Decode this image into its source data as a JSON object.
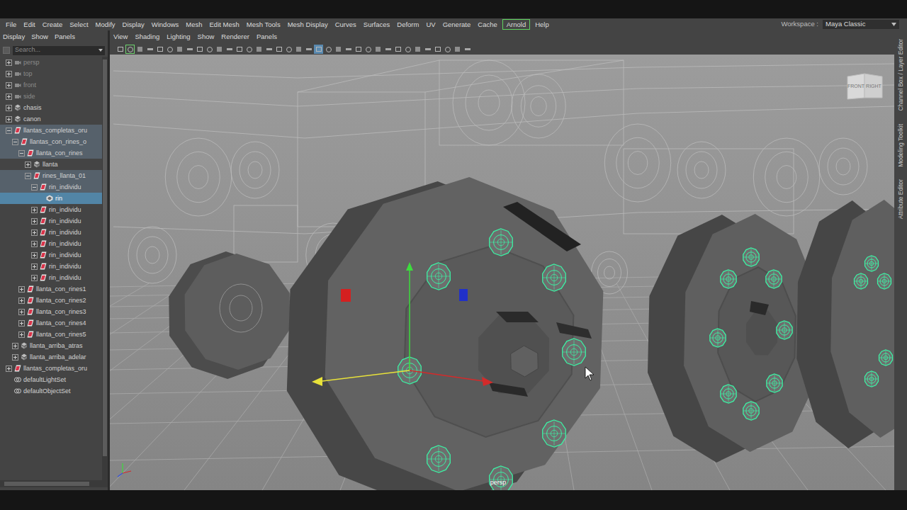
{
  "menubar": {
    "items": [
      {
        "label": "File",
        "highlighted": false
      },
      {
        "label": "Edit",
        "highlighted": false
      },
      {
        "label": "Create",
        "highlighted": false
      },
      {
        "label": "Select",
        "highlighted": false
      },
      {
        "label": "Modify",
        "highlighted": false
      },
      {
        "label": "Display",
        "highlighted": false
      },
      {
        "label": "Windows",
        "highlighted": false
      },
      {
        "label": "Mesh",
        "highlighted": false
      },
      {
        "label": "Edit Mesh",
        "highlighted": false
      },
      {
        "label": "Mesh Tools",
        "highlighted": false
      },
      {
        "label": "Mesh Display",
        "highlighted": false
      },
      {
        "label": "Curves",
        "highlighted": false
      },
      {
        "label": "Surfaces",
        "highlighted": false
      },
      {
        "label": "Deform",
        "highlighted": false
      },
      {
        "label": "UV",
        "highlighted": false
      },
      {
        "label": "Generate",
        "highlighted": false
      },
      {
        "label": "Cache",
        "highlighted": false
      },
      {
        "label": "Arnold",
        "highlighted": true
      },
      {
        "label": "Help",
        "highlighted": false
      }
    ],
    "workspace_label": "Workspace :",
    "workspace_value": "Maya Classic"
  },
  "outliner": {
    "menu": [
      "Display",
      "Show",
      "Panels"
    ],
    "search": {
      "placeholder": "Search..."
    },
    "items": [
      {
        "label": "persp",
        "depth": 0,
        "has_children": true,
        "expanded": false,
        "kind": "camera",
        "selected": false,
        "ancestor": false,
        "dimmed": true
      },
      {
        "label": "top",
        "depth": 0,
        "has_children": true,
        "expanded": false,
        "kind": "camera",
        "selected": false,
        "ancestor": false,
        "dimmed": true
      },
      {
        "label": "front",
        "depth": 0,
        "has_children": true,
        "expanded": false,
        "kind": "camera",
        "selected": false,
        "ancestor": false,
        "dimmed": true
      },
      {
        "label": "side",
        "depth": 0,
        "has_children": true,
        "expanded": false,
        "kind": "camera",
        "selected": false,
        "ancestor": false,
        "dimmed": true
      },
      {
        "label": "chasis",
        "depth": 0,
        "has_children": true,
        "expanded": false,
        "kind": "group",
        "selected": false,
        "ancestor": false,
        "dimmed": false
      },
      {
        "label": "canon",
        "depth": 0,
        "has_children": true,
        "expanded": false,
        "kind": "group",
        "selected": false,
        "ancestor": false,
        "dimmed": false
      },
      {
        "label": "llantas_completas_oru",
        "depth": 0,
        "has_children": true,
        "expanded": true,
        "kind": "transform",
        "selected": false,
        "ancestor": true,
        "dimmed": false
      },
      {
        "label": "llantas_con_rines_o",
        "depth": 1,
        "has_children": true,
        "expanded": true,
        "kind": "transform",
        "selected": false,
        "ancestor": true,
        "dimmed": false
      },
      {
        "label": "llanta_con_rines",
        "depth": 2,
        "has_children": true,
        "expanded": true,
        "kind": "transform",
        "selected": false,
        "ancestor": true,
        "dimmed": false
      },
      {
        "label": "llanta",
        "depth": 3,
        "has_children": true,
        "expanded": false,
        "kind": "group",
        "selected": false,
        "ancestor": false,
        "dimmed": false
      },
      {
        "label": "rines_llanta_01",
        "depth": 3,
        "has_children": true,
        "expanded": true,
        "kind": "transform",
        "selected": false,
        "ancestor": true,
        "dimmed": false
      },
      {
        "label": "rin_individu",
        "depth": 4,
        "has_children": true,
        "expanded": true,
        "kind": "transform",
        "selected": false,
        "ancestor": true,
        "dimmed": false
      },
      {
        "label": "rin",
        "depth": 5,
        "has_children": false,
        "expanded": false,
        "kind": "mesh",
        "selected": true,
        "ancestor": false,
        "dimmed": false
      },
      {
        "label": "rin_individu",
        "depth": 4,
        "has_children": true,
        "expanded": false,
        "kind": "transform",
        "selected": false,
        "ancestor": false,
        "dimmed": false
      },
      {
        "label": "rin_individu",
        "depth": 4,
        "has_children": true,
        "expanded": false,
        "kind": "transform",
        "selected": false,
        "ancestor": false,
        "dimmed": false
      },
      {
        "label": "rin_individu",
        "depth": 4,
        "has_children": true,
        "expanded": false,
        "kind": "transform",
        "selected": false,
        "ancestor": false,
        "dimmed": false
      },
      {
        "label": "rin_individu",
        "depth": 4,
        "has_children": true,
        "expanded": false,
        "kind": "transform",
        "selected": false,
        "ancestor": false,
        "dimmed": false
      },
      {
        "label": "rin_individu",
        "depth": 4,
        "has_children": true,
        "expanded": false,
        "kind": "transform",
        "selected": false,
        "ancestor": false,
        "dimmed": false
      },
      {
        "label": "rin_individu",
        "depth": 4,
        "has_children": true,
        "expanded": false,
        "kind": "transform",
        "selected": false,
        "ancestor": false,
        "dimmed": false
      },
      {
        "label": "rin_individu",
        "depth": 4,
        "has_children": true,
        "expanded": false,
        "kind": "transform",
        "selected": false,
        "ancestor": false,
        "dimmed": false
      },
      {
        "label": "llanta_con_rines1",
        "depth": 2,
        "has_children": true,
        "expanded": false,
        "kind": "transform",
        "selected": false,
        "ancestor": false,
        "dimmed": false
      },
      {
        "label": "llanta_con_rines2",
        "depth": 2,
        "has_children": true,
        "expanded": false,
        "kind": "transform",
        "selected": false,
        "ancestor": false,
        "dimmed": false
      },
      {
        "label": "llanta_con_rines3",
        "depth": 2,
        "has_children": true,
        "expanded": false,
        "kind": "transform",
        "selected": false,
        "ancestor": false,
        "dimmed": false
      },
      {
        "label": "llanta_con_rines4",
        "depth": 2,
        "has_children": true,
        "expanded": false,
        "kind": "transform",
        "selected": false,
        "ancestor": false,
        "dimmed": false
      },
      {
        "label": "llanta_con_rines5",
        "depth": 2,
        "has_children": true,
        "expanded": false,
        "kind": "transform",
        "selected": false,
        "ancestor": false,
        "dimmed": false
      },
      {
        "label": "llanta_arriba_atras",
        "depth": 1,
        "has_children": true,
        "expanded": false,
        "kind": "group",
        "selected": false,
        "ancestor": false,
        "dimmed": false
      },
      {
        "label": "llanta_arriba_adelar",
        "depth": 1,
        "has_children": true,
        "expanded": false,
        "kind": "group",
        "selected": false,
        "ancestor": false,
        "dimmed": false
      },
      {
        "label": "llantas_completas_oru",
        "depth": 0,
        "has_children": true,
        "expanded": false,
        "kind": "transform",
        "selected": false,
        "ancestor": false,
        "dimmed": false
      },
      {
        "label": "defaultLightSet",
        "depth": 0,
        "has_children": false,
        "expanded": false,
        "kind": "set",
        "selected": false,
        "ancestor": false,
        "dimmed": false
      },
      {
        "label": "defaultObjectSet",
        "depth": 0,
        "has_children": false,
        "expanded": false,
        "kind": "set",
        "selected": false,
        "ancestor": false,
        "dimmed": false
      }
    ]
  },
  "viewport": {
    "menu": [
      "View",
      "Shading",
      "Lighting",
      "Show",
      "Renderer",
      "Panels"
    ],
    "toolbar": [
      {
        "active": false
      },
      {
        "active": true
      },
      {
        "active": false
      },
      {
        "active": false
      },
      {
        "active": false
      },
      {
        "active": false
      },
      {
        "active": false
      },
      {
        "active": false
      },
      {
        "active": false
      },
      {
        "active": false
      },
      {
        "active": false
      },
      {
        "active": false
      },
      {
        "active": false
      },
      {
        "active": false
      },
      {
        "active": false
      },
      {
        "active": false
      },
      {
        "active": false
      },
      {
        "active": false
      },
      {
        "active": false
      },
      {
        "active": false
      },
      {
        "active": true
      },
      {
        "active": false
      },
      {
        "active": false
      },
      {
        "active": false
      },
      {
        "active": false
      },
      {
        "active": false
      },
      {
        "active": false
      },
      {
        "active": false
      },
      {
        "active": false
      },
      {
        "active": false
      },
      {
        "active": false
      },
      {
        "active": false
      },
      {
        "active": false
      },
      {
        "active": false
      },
      {
        "active": false
      },
      {
        "active": false
      }
    ],
    "camera_label": "persp",
    "view_cube": [
      "FRONT",
      "RIGHT"
    ]
  },
  "side_tabs": [
    "Channel Box / Layer Editor",
    "Modeling Toolkit",
    "Attribute Editor"
  ]
}
